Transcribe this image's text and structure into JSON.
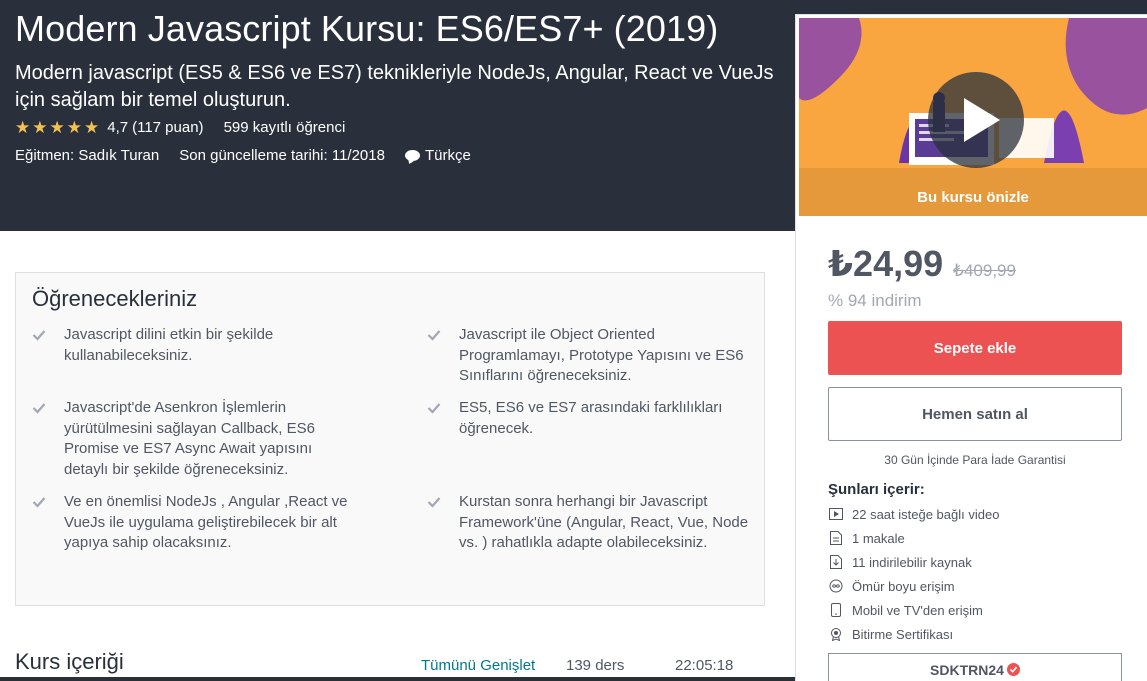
{
  "course": {
    "title": "Modern Javascript Kursu: ES6/ES7+ (2019)",
    "subtitle": "Modern javascript (ES5 & ES6 ve ES7) teknikleriyle NodeJs, Angular, React ve VueJs için sağlam bir temel oluşturun.",
    "rating_value": "4,7",
    "rating_count": "(117 puan)",
    "rating_stars": 4.7,
    "students": "599 kayıtlı öğrenci",
    "instructor": "Eğitmen: Sadık Turan",
    "last_updated": "Son güncelleme tarihi: 11/2018",
    "language": "Türkçe"
  },
  "sidebar": {
    "preview_label": "Bu kursu önizle",
    "price": "₺24,99",
    "old_price": "₺409,99",
    "discount": "% 94 indirim",
    "add_to_cart": "Sepete ekle",
    "buy_now": "Hemen satın al",
    "guarantee": "30 Gün İçinde Para İade Garantisi",
    "includes_title": "Şunları içerir:",
    "includes": [
      {
        "icon": "video-icon",
        "label": "22 saat isteğe bağlı video"
      },
      {
        "icon": "article-icon",
        "label": "1 makale"
      },
      {
        "icon": "download-icon",
        "label": "11 indirilebilir kaynak"
      },
      {
        "icon": "infinity-icon",
        "label": "Ömür boyu erişim"
      },
      {
        "icon": "mobile-icon",
        "label": "Mobil ve TV'den erişim"
      },
      {
        "icon": "certificate-icon",
        "label": "Bitirme Sertifikası"
      }
    ],
    "coupon_code": "SDKTRN24"
  },
  "learn": {
    "title": "Öğrenecekleriniz",
    "items": [
      "Javascript dilini etkin bir şekilde kullanabileceksiniz.",
      "Javascript ile Object Oriented Programlamayı, Prototype Yapısını ve ES6 Sınıflarını öğreneceksiniz.",
      "Javascript'de Asenkron İşlemlerin yürütülmesini sağlayan Callback, ES6 Promise ve ES7 Async Await yapısını detaylı bir şekilde öğreneceksiniz.",
      "ES5, ES6 ve ES7 arasındaki farklılıkları öğrenecek.",
      "Ve en önemlisi NodeJs , Angular ,React ve VueJs ile uygulama geliştirebilecek bir alt yapıya sahip olacaksınız.",
      "Kurstan sonra herhangi bir Javascript Framework'üne (Angular, React, Vue, Node vs. ) rahatlıkla adapte olabileceksiniz."
    ]
  },
  "content": {
    "title": "Kurs içeriği",
    "expand_all": "Tümünü Genişlet",
    "lecture_count": "139 ders",
    "duration": "22:05:18"
  },
  "colors": {
    "hero_bg": "#29303b",
    "star": "#f4c150",
    "primary_button": "#ec5252",
    "link": "#007791",
    "preview_bg": "#f9a640"
  }
}
